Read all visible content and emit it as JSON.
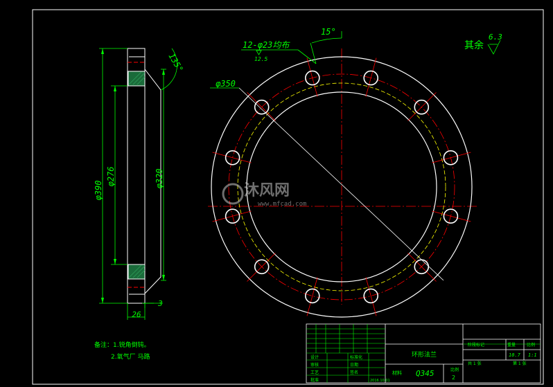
{
  "drawing": {
    "background": "#000000",
    "line_color": "#ffffff",
    "dimension_color": "#00ff00",
    "centerline_color": "#ff0000",
    "pitch_circle_color": "#ffff00",
    "section_fill_color": "#1a6b3a"
  },
  "side_view": {
    "dim_390": "φ390",
    "dim_276": "φ276",
    "dim_320": "φ320",
    "dim_26": "26",
    "dim_3": "3",
    "chamfer_angle": "135°"
  },
  "front_view": {
    "holes_callout": "12-φ23均布",
    "hole_roughness": "12.5",
    "pcd_label": "φ350",
    "angle_label": "15°",
    "bolt_hole_count": 12
  },
  "roughness_note": {
    "prefix": "其余",
    "value": "6.3"
  },
  "notes": {
    "line1": "备注：1.锐角倒钝。",
    "line2": "2.氧气厂 马路"
  },
  "watermark": {
    "brand": "沐风网",
    "url": "www.mfcad.com"
  },
  "title_block": {
    "part_name": "环形法兰",
    "material_label": "材料",
    "material": "Q345",
    "scale_label": "比例",
    "scale": "1:1",
    "weight_label": "重量",
    "weight": "10.7",
    "stage_label": "阶段标记",
    "sheet_label": "共 1 张",
    "sheet_no": "第 1 张",
    "rows": [
      "设计",
      "审核",
      "工艺",
      "批准"
    ],
    "row_values": [
      "标准化",
      "日期",
      "签名",
      "2016.10.01"
    ],
    "corner_value": "2"
  }
}
